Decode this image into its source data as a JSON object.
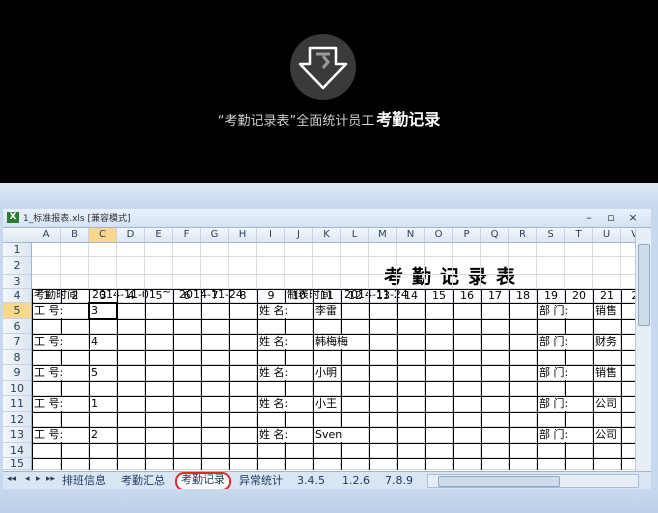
{
  "hero": {
    "caption_prefix": "“考勤记录表”全面统计员工",
    "caption_strong": "考勤记录"
  },
  "window": {
    "title": "1_标准报表.xls  [兼容模式]",
    "minimize_glyph": "–",
    "restore_glyph": "▫",
    "close_glyph": "×"
  },
  "columns": [
    "A",
    "B",
    "C",
    "D",
    "E",
    "F",
    "G",
    "H",
    "I",
    "J",
    "K",
    "L",
    "M",
    "N",
    "O",
    "P",
    "Q",
    "R",
    "S",
    "T",
    "U",
    "V"
  ],
  "active_column": "C",
  "rows": [
    "1",
    "2",
    "3",
    "4",
    "5",
    "6",
    "7",
    "8",
    "9",
    "10",
    "11",
    "12",
    "13",
    "14",
    "15"
  ],
  "active_row": "5",
  "sheet": {
    "title": "考勤记录表",
    "period_label": "考勤时间",
    "period_from": "2014-11-01",
    "period_sep": "~",
    "period_to": "2014-11-24",
    "made_label": "制表时间",
    "made_date": "2014-11-24",
    "day_numbers": [
      "1",
      "2",
      "3",
      "4",
      "5",
      "6",
      "7",
      "8",
      "9",
      "10",
      "11",
      "12",
      "13",
      "14",
      "15",
      "16",
      "17",
      "18",
      "19",
      "20",
      "21",
      "2"
    ],
    "id_label": "工  号:",
    "name_label": "姓  名:",
    "dept_label": "部  门:",
    "employees": [
      {
        "id": "3",
        "name": "李雷",
        "dept": "销售"
      },
      {
        "id": "4",
        "name": "韩梅梅",
        "dept": "财务"
      },
      {
        "id": "5",
        "name": "小明",
        "dept": "销售"
      },
      {
        "id": "1",
        "name": "小王",
        "dept": "公司"
      },
      {
        "id": "2",
        "name": "Sven",
        "dept": "公司"
      }
    ]
  },
  "sheet_nav": [
    "◂◂",
    "◂",
    "▸",
    "▸▸"
  ],
  "tabs": [
    {
      "label": "排班信息"
    },
    {
      "label": "考勤汇总"
    },
    {
      "label": "考勤记录",
      "active": true
    },
    {
      "label": "异常统计"
    },
    {
      "label": "3.4.5"
    },
    {
      "label": "1.2.6"
    },
    {
      "label": "7.8.9"
    }
  ],
  "colors": {
    "selected_header": "#f9d78c",
    "active_tab_outline": "#e2262c",
    "excel_chrome": "#c7d9ee"
  }
}
